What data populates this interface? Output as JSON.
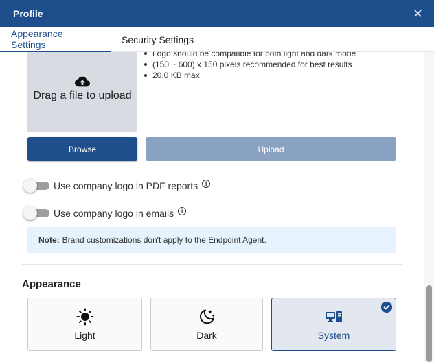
{
  "header": {
    "title": "Profile",
    "close_glyph": "✕"
  },
  "tabs": [
    {
      "label": "Appearance Settings",
      "active": true
    },
    {
      "label": "Security Settings",
      "active": false
    }
  ],
  "logo_upload": {
    "drop_text": "Drag a file to upload",
    "requirements": [
      "Logo should be compatible for both light and dark mode",
      "(150 ~ 600) x 150 pixels recommended for best results",
      "20.0 KB max"
    ],
    "browse_label": "Browse",
    "upload_label": "Upload"
  },
  "toggles": [
    {
      "label": "Use company logo in PDF reports",
      "enabled": false
    },
    {
      "label": "Use company logo in emails",
      "enabled": false
    }
  ],
  "note": {
    "prefix": "Note:",
    "text": "Brand customizations don't apply to the Endpoint Agent."
  },
  "appearance": {
    "title": "Appearance",
    "options": [
      {
        "label": "Light",
        "icon": "sun-icon",
        "selected": false
      },
      {
        "label": "Dark",
        "icon": "moon-stars-icon",
        "selected": false
      },
      {
        "label": "System",
        "icon": "monitor-desktop-icon",
        "selected": true
      }
    ]
  },
  "colors": {
    "primary": "#1f4e8c",
    "disabled_button": "#89a2c1",
    "note_background": "#e6f2fd",
    "dropzone": "#d8dbe2"
  }
}
